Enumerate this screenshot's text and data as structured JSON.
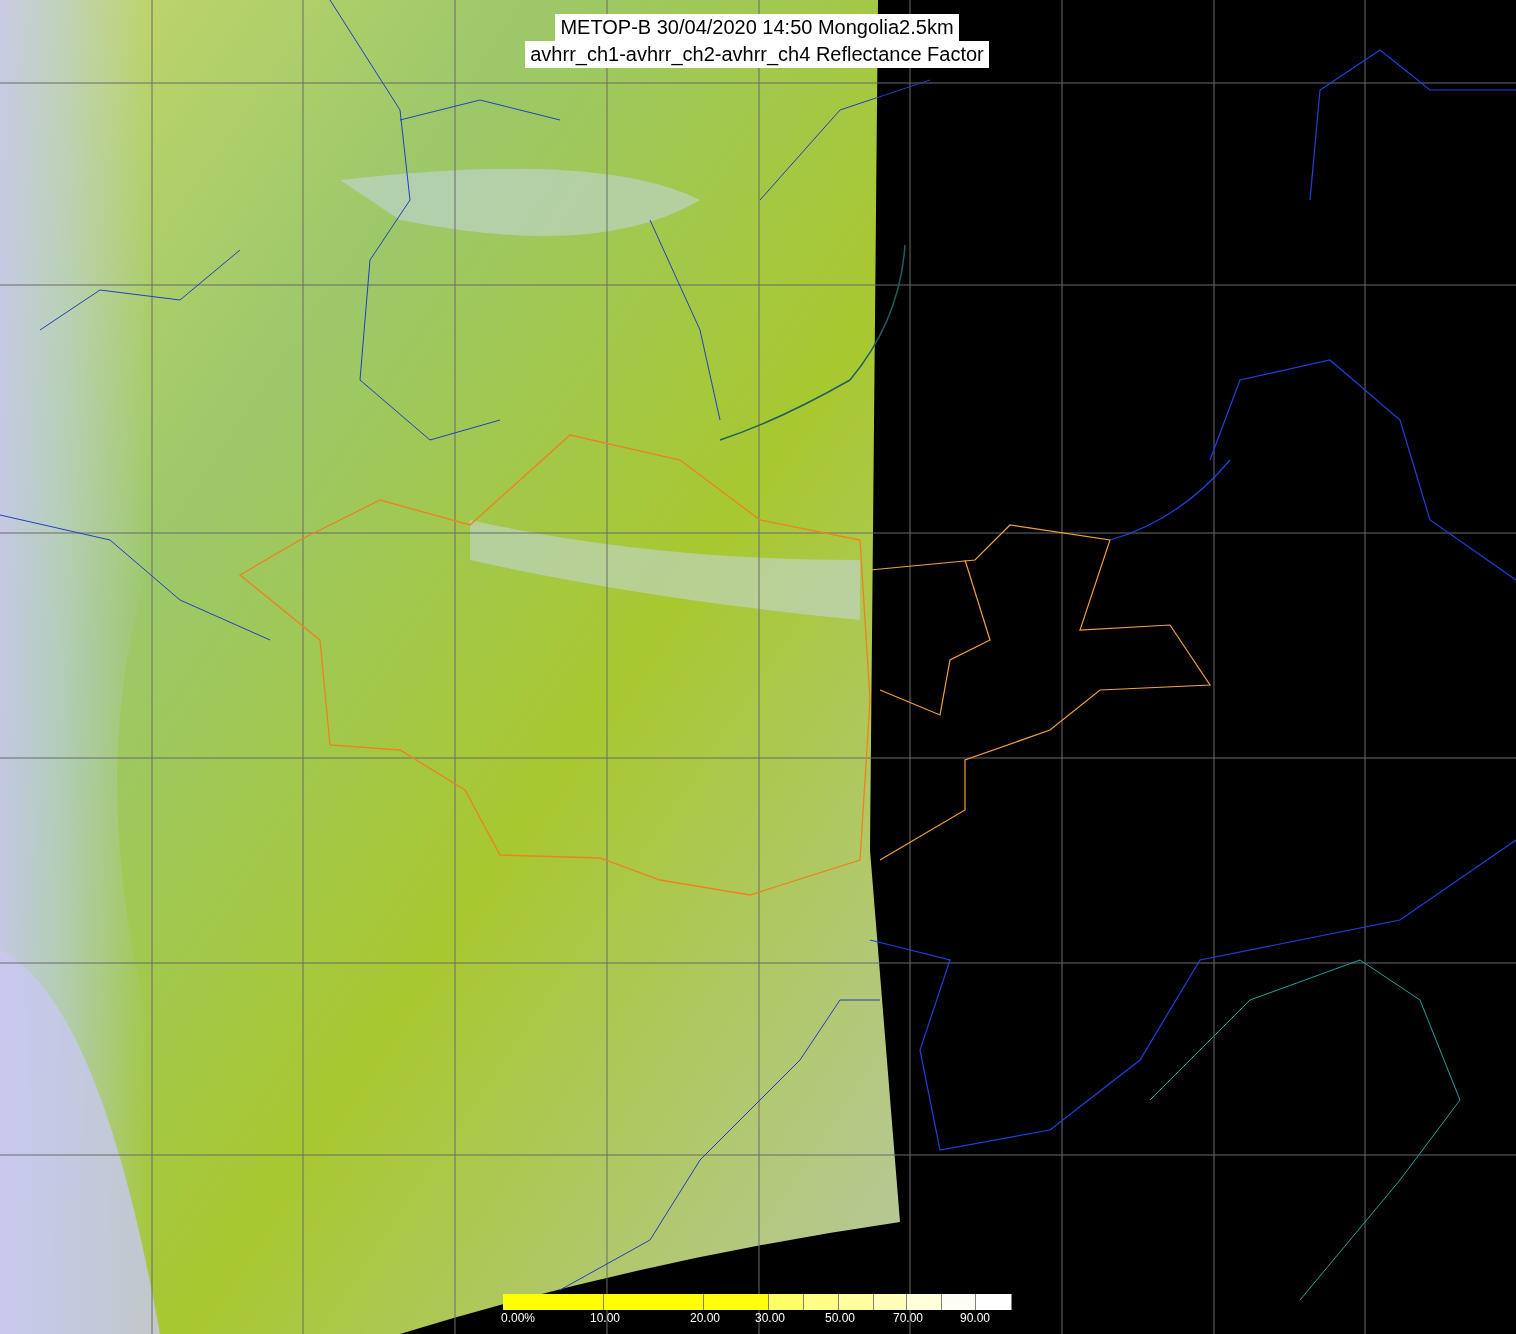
{
  "title": {
    "lines": [
      "METOP-B 30/04/2020 14:50 Mongolia2.5km",
      "avhrr_ch1-avhrr_ch2-avhrr_ch4 Reflectance Factor"
    ]
  },
  "legend": {
    "segments": [
      {
        "color": "#ffff00"
      },
      {
        "color": "#ffff00"
      },
      {
        "color": "#ffff10"
      },
      {
        "color": "#ffff66"
      },
      {
        "color": "#ffff88"
      },
      {
        "color": "#ffffa0"
      },
      {
        "color": "#ffffbb"
      },
      {
        "color": "#ffffd8"
      },
      {
        "color": "#fdfdf4"
      },
      {
        "color": "#ffffff"
      }
    ],
    "labels": [
      "0.00%",
      "10.00",
      "20.00",
      "30.00",
      "50.00",
      "70.00",
      "90.00"
    ]
  }
}
